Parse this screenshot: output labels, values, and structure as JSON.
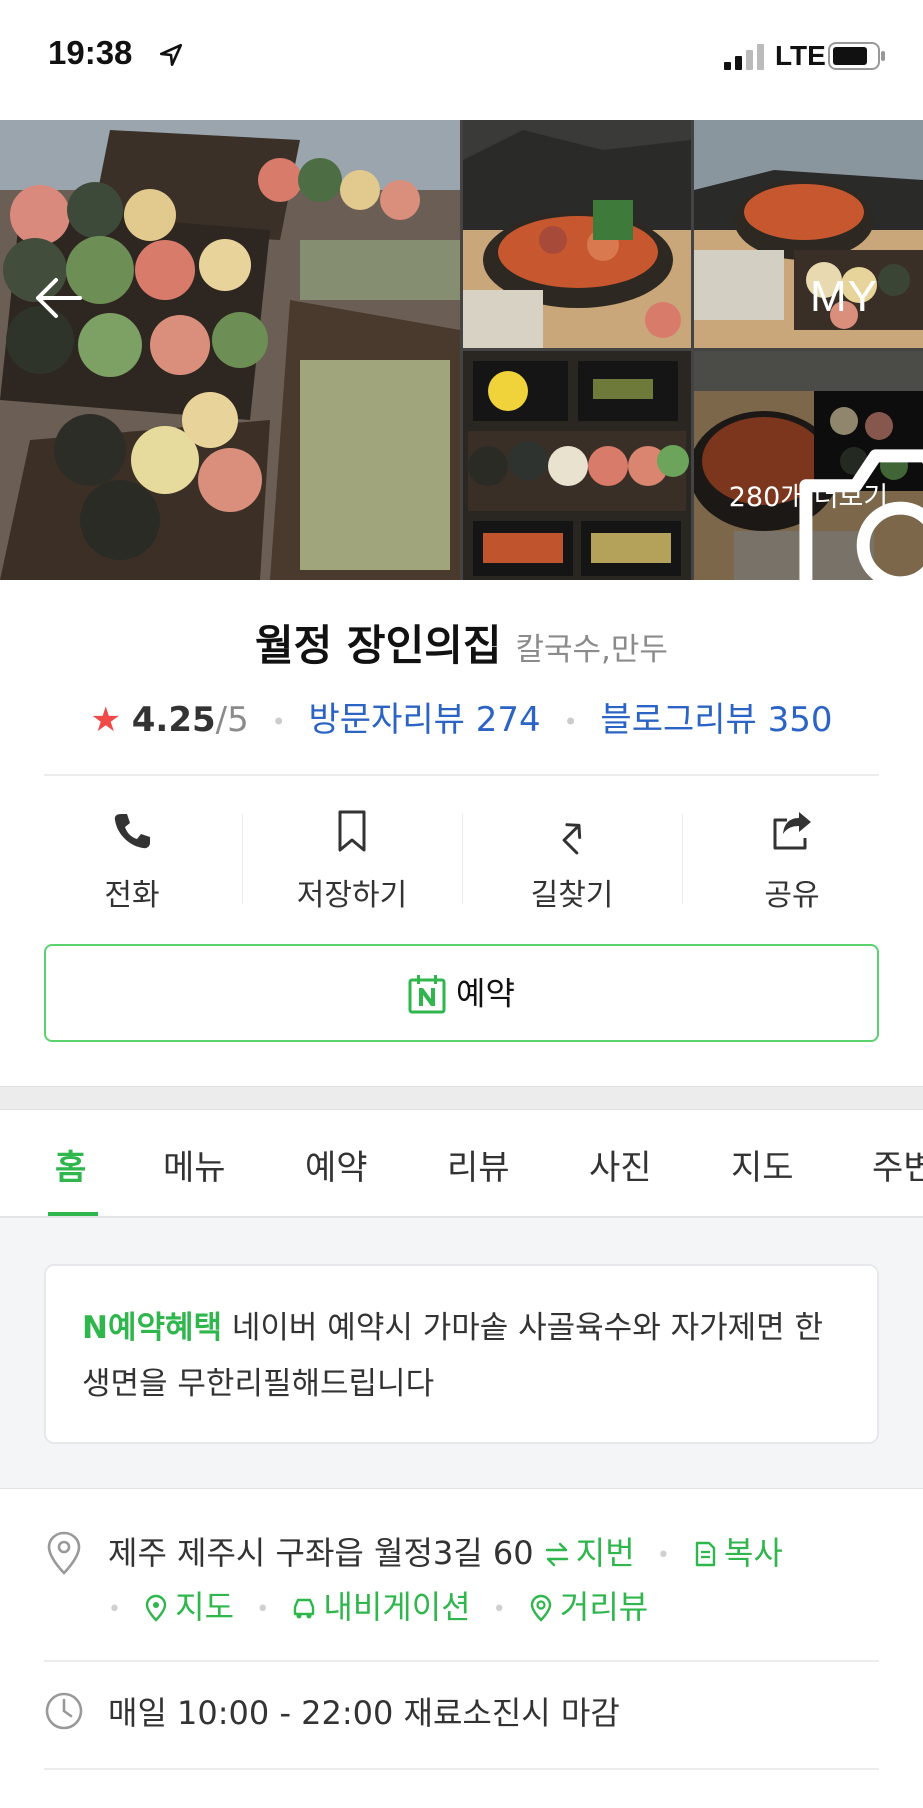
{
  "status_bar": {
    "time": "19:38",
    "network": "LTE"
  },
  "header": {
    "my_label": "MY"
  },
  "gallery": {
    "more_text": "280개 더보기"
  },
  "place": {
    "name": "월정 장인의집",
    "category": "칼국수,만두",
    "rating": "4.25",
    "rating_max": "/5",
    "visitor_review": "방문자리뷰 274",
    "blog_review": "블로그리뷰 350"
  },
  "actions": [
    {
      "label": "전화",
      "icon": "phone-icon"
    },
    {
      "label": "저장하기",
      "icon": "bookmark-icon"
    },
    {
      "label": "길찾기",
      "icon": "directions-icon"
    },
    {
      "label": "공유",
      "icon": "share-icon"
    }
  ],
  "reserve": {
    "label": "예약",
    "icon": "naver-booking-icon"
  },
  "tabs": [
    "홈",
    "메뉴",
    "예약",
    "리뷰",
    "사진",
    "지도",
    "주변"
  ],
  "active_tab": "홈",
  "notice": {
    "tag": "N예약혜택",
    "text": " 네이버 예약시 가마솥 사골육수와 자가제면 한 생면을 무한리필해드립니다"
  },
  "address": {
    "text": "제주 제주시 구좌읍 월정3길 60",
    "lot_label": "지번",
    "copy_label": "복사",
    "map_label": "지도",
    "navigation_label": "내비게이션",
    "street_view_label": "거리뷰"
  },
  "hours": {
    "text": "매일 10:00 - 22:00 재료소진시 마감"
  },
  "colors": {
    "accent_green": "#2fb64c",
    "link_blue": "#2b64c4",
    "star_red": "#f04a48"
  }
}
